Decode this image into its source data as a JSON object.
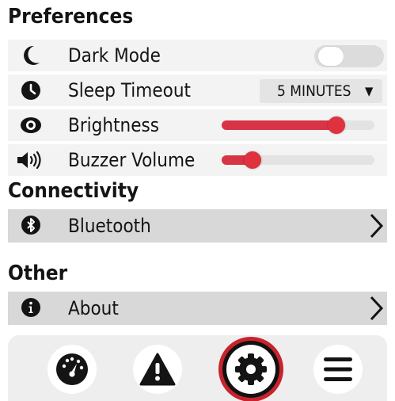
{
  "sections": {
    "preferences": "Preferences",
    "connectivity": "Connectivity",
    "other": "Other"
  },
  "preferences": {
    "dark_mode": {
      "label": "Dark Mode",
      "icon": "moon-icon",
      "enabled": false
    },
    "sleep_timeout": {
      "label": "Sleep Timeout",
      "icon": "clock-icon",
      "value": "5 MINUTES",
      "caret": "▼"
    },
    "brightness": {
      "label": "Brightness",
      "icon": "eye-icon",
      "level": 0.75
    },
    "buzzer_volume": {
      "label": "Buzzer Volume",
      "icon": "speaker-icon",
      "level": 0.2
    }
  },
  "connectivity": {
    "bluetooth": {
      "label": "Bluetooth",
      "icon": "bluetooth-icon"
    }
  },
  "other": {
    "about": {
      "label": "About",
      "icon": "info-icon"
    }
  },
  "tabbar": {
    "tabs": [
      {
        "name": "dashboard",
        "icon": "gauge-icon"
      },
      {
        "name": "alerts",
        "icon": "warning-icon"
      },
      {
        "name": "settings",
        "icon": "gear-icon",
        "active": true
      },
      {
        "name": "menu",
        "icon": "hamburger-icon"
      }
    ]
  },
  "colors": {
    "accent": "#d73545",
    "active_ring": "#c8232c",
    "row_bg": "#f3f3f3",
    "nav_row_bg": "#d8d8d8"
  }
}
